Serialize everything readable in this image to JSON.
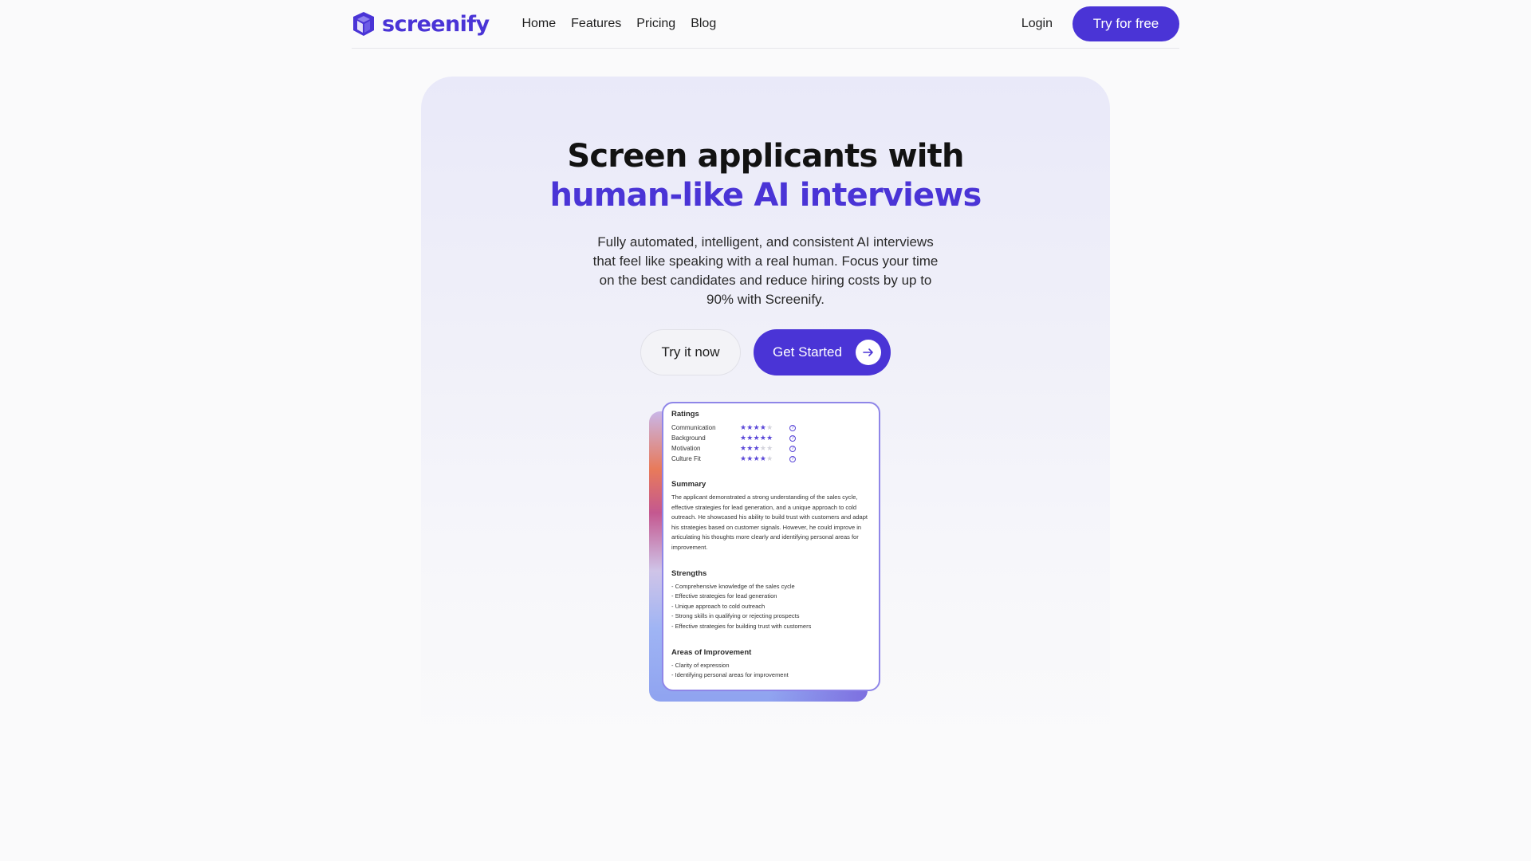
{
  "nav": {
    "brand": "screenify",
    "links": [
      "Home",
      "Features",
      "Pricing",
      "Blog"
    ],
    "login": "Login",
    "cta": "Try for free"
  },
  "hero": {
    "title_line1": "Screen applicants with",
    "title_line2": "human-like AI interviews",
    "lead": "Fully automated, intelligent, and consistent AI interviews that feel like speaking with a real human. Focus your time on the best candidates and reduce hiring costs by up to 90% with Screenify.",
    "btn_try": "Try it now",
    "btn_start": "Get Started"
  },
  "report": {
    "ratings_title": "Ratings",
    "ratings": [
      {
        "label": "Communication",
        "stars": 4
      },
      {
        "label": "Background",
        "stars": 5
      },
      {
        "label": "Motivation",
        "stars": 3
      },
      {
        "label": "Culture Fit",
        "stars": 4
      }
    ],
    "summary_title": "Summary",
    "summary": "The applicant demonstrated a strong understanding of the sales cycle, effective strategies for lead generation, and a unique approach to cold outreach. He showcased his ability to build trust with customers and adapt his strategies based on customer signals. However, he could improve in articulating his thoughts more clearly and identifying personal areas for improvement.",
    "strengths_title": "Strengths",
    "strengths": [
      "- Comprehensive knowledge of the sales cycle",
      "- Effective strategies for lead generation",
      "- Unique approach to cold outreach",
      "- Strong skills in qualifying or rejecting prospects",
      "- Effective strategies for building trust with customers"
    ],
    "improvement_title": "Areas of Improvement",
    "improvements": [
      "- Clarity of expression",
      "- Identifying personal areas for improvement"
    ]
  },
  "colors": {
    "brand": "#4a34d6",
    "background": "#fafafb"
  },
  "icons": {
    "logo": "shield-logo-icon",
    "arrow": "arrow-right-icon",
    "star": "star-icon",
    "help": "help-circle-icon"
  }
}
